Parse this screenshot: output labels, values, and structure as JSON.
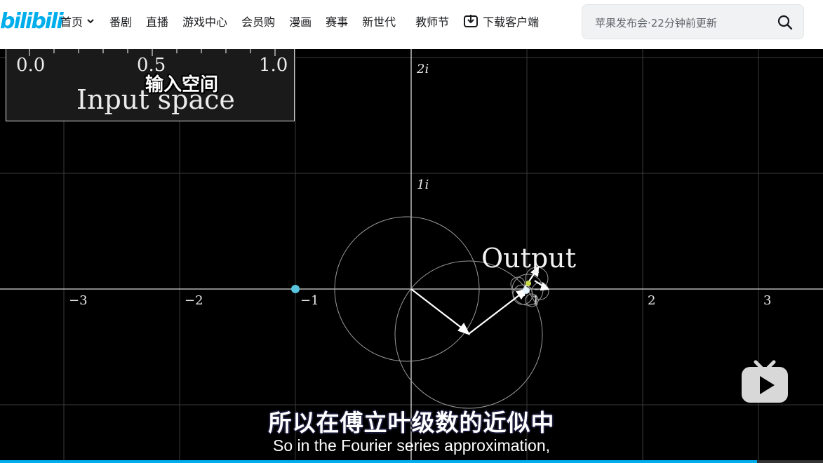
{
  "header": {
    "logo_text": "bilibili",
    "nav": [
      {
        "label": "首页",
        "has_dropdown": true,
        "icon": "chevron-down-icon"
      },
      {
        "label": "番剧"
      },
      {
        "label": "直播"
      },
      {
        "label": "游戏中心"
      },
      {
        "label": "会员购"
      },
      {
        "label": "漫画"
      },
      {
        "label": "赛事"
      },
      {
        "label": "新世代"
      },
      {
        "label": "教师节"
      },
      {
        "label": "下载客户端",
        "icon": "download-icon"
      }
    ],
    "search": {
      "placeholder": "苹果发布会·22分钟前更新",
      "icon": "search-icon"
    }
  },
  "video": {
    "input_panel": {
      "ticks": [
        "0.0",
        "0.5",
        "1.0"
      ],
      "title": "Input space",
      "overlay_cn": "输入空间"
    },
    "plot": {
      "x_tick_labels": [
        "−3",
        "−2",
        "−1",
        "1",
        "2",
        "3"
      ],
      "y_tick_labels": [
        "2i",
        "1i"
      ],
      "output_label": "Output",
      "input_point_value": -1.0
    },
    "subtitle_cn": "所以在傅立叶级数的近似中",
    "subtitle_en": "So in the Fourier series approximation,",
    "play_icon": "play-icon",
    "progress": 0.92
  },
  "colors": {
    "accent": "#00aeec",
    "point": "#58c4dd",
    "background": "#000000"
  }
}
